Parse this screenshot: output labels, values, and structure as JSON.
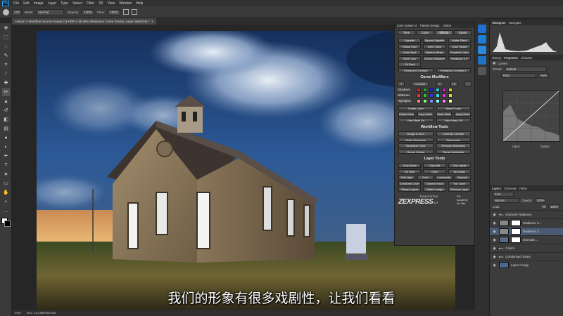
{
  "menubar": {
    "logo": "Ps",
    "items": [
      "File",
      "Edit",
      "Image",
      "Layer",
      "Type",
      "Select",
      "Filter",
      "3D",
      "View",
      "Window",
      "Help"
    ]
  },
  "options": {
    "mode_label": "Mode:",
    "mode_value": "Normal",
    "opacity_label": "Opacity:",
    "opacity_value": "100%",
    "flow_label": "Flow:",
    "flow_value": "100%",
    "brush_size": "175"
  },
  "document": {
    "tab_title": "Lesson 4 Workflow Source Image (1)-HDR-2 @ 26% (Radiance Curve Drama, Layer Mask/16) *",
    "zoom": "26%",
    "doc_info": "Doc: 113.8M/502.8M"
  },
  "zone": {
    "header": [
      "Zone System 4",
      "Palette Design",
      "Action"
    ],
    "tabs": [
      "Tone",
      "Color",
      "Effects",
      "Export"
    ],
    "effects": [
      "Vignette",
      "Square Vignette",
      "Matte Effect",
      "Radial Sunr",
      "Deep Sand",
      "Color Shade",
      "Solar Spot",
      "Black & White",
      "Gradient Color",
      "Solid Color",
      "Dramic Radiance",
      "Radiance 2.0",
      "Glt Paint",
      "Enhanced Contrast",
      "Enhanced Contrast 2"
    ],
    "curve_title": "Curve Modifiers",
    "curve_top": [
      "+",
      "S-Curve",
      "+",
      "+2",
      "-"
    ],
    "curve_rows": [
      "Shadows",
      "Midtones",
      "Highlights"
    ],
    "curve_btns": [
      "Toggle Layer",
      "Reset Curve",
      "Delete Mask",
      "Copy Mask",
      "Paste Mask",
      "Apply Mask",
      "View Mask On",
      "View Mask Off"
    ],
    "workflow_title": "Workflow Tools",
    "workflow": [
      "Dodge & Burn",
      "Contrast Checker",
      "Noise Reduction",
      "Sharpening",
      "Neutralize Color",
      "Remove Aberration",
      "Repair Clouds",
      "Repair Waterfalls"
    ],
    "layer_title": "Layer Tools",
    "layer_tools": [
      "Only Darks",
      "Only Mid",
      "Only Lights",
      "No Dark",
      "Clear",
      "No Lights",
      "Soft Light",
      "Color",
      "Luminosity",
      "Normal",
      "Duplicate Layer",
      "Clipping Mask",
      "Top Layer",
      "Stamp Layers",
      "Flatten Image",
      "Remove Layer"
    ],
    "logo_main": "ZEXPRESS",
    "logo_top": "ZONE SYSTEM",
    "logo_ver": "4.0",
    "logo_right": "RH Academy Art Site"
  },
  "histogram": {
    "tabs": [
      "Histogram",
      "Navigator"
    ]
  },
  "properties": {
    "tabs": [
      "History",
      "Properties",
      "Libraries"
    ],
    "title": "Curves",
    "preset_label": "Preset:",
    "preset_value": "Default",
    "channel": "RGB",
    "auto": "Auto",
    "input": "Input:",
    "output": "Output:"
  },
  "layers": {
    "tabs": [
      "Layers",
      "Channels",
      "Paths"
    ],
    "kind": "Kind",
    "blend": "Normal",
    "opacity_label": "Opacity:",
    "opacity_value": "100%",
    "lock_label": "Lock:",
    "fill_label": "Fill:",
    "fill_value": "100%",
    "items": [
      "Dramatic Radiance",
      "Radiance C...",
      "Radiance C...",
      "Dramatic ...",
      "Colors",
      "Condensed Tones",
      "Layer 0 copy"
    ]
  },
  "subtitle": "我们的形象有很多戏剧性，让我们看看"
}
